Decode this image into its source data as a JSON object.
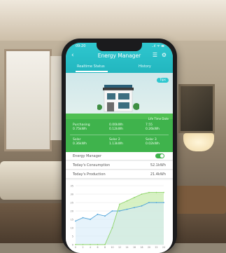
{
  "status": {
    "time": "09:20",
    "signal": "..ıl ᯤ ▬"
  },
  "header": {
    "title": "Energy Manager",
    "back_icon": "arrow-left-icon",
    "menu_icon": "menu-icon",
    "settings_icon": "gear-icon"
  },
  "tabs": [
    {
      "label": "Realtime Status"
    },
    {
      "label": "History"
    }
  ],
  "hero": {
    "badge": "Tips",
    "note": "Life Time Date"
  },
  "stats": {
    "row1": [
      "Purchasing\n0.75kWh",
      "0.00kWh\n0.12kWh",
      "7.55\n0.26kWh"
    ],
    "row2": [
      "Solar\n0.36kWh",
      "Solar 2\n1.13kWh",
      "Solar 3\n0.02kWh"
    ]
  },
  "rows": {
    "energy_manager": "Energy Manager",
    "consumption_label": "Today's Consumption",
    "consumption_value": "52.1kWh",
    "production_label": "Today's Production",
    "production_value": "21.4kWh"
  },
  "colors": {
    "accent": "#2fc7cf",
    "green": "#3fb34c",
    "line_blue": "#4fa3d9",
    "line_green": "#8fd46a"
  },
  "chart_data": {
    "type": "line",
    "x": [
      0,
      2,
      4,
      6,
      8,
      10,
      12,
      14,
      16,
      18,
      20,
      22,
      24
    ],
    "xlim": [
      0,
      24
    ],
    "ylim": [
      0,
      35
    ],
    "yticks": [
      0,
      5,
      10,
      15,
      20,
      25,
      30,
      35
    ],
    "series": [
      {
        "values": [
          14,
          16,
          15,
          18,
          17,
          20,
          20,
          21,
          22,
          23,
          25,
          25,
          25
        ]
      },
      {
        "values": [
          0,
          0,
          0,
          0,
          0,
          10,
          24,
          26,
          28,
          30,
          31,
          31,
          31
        ]
      }
    ]
  }
}
